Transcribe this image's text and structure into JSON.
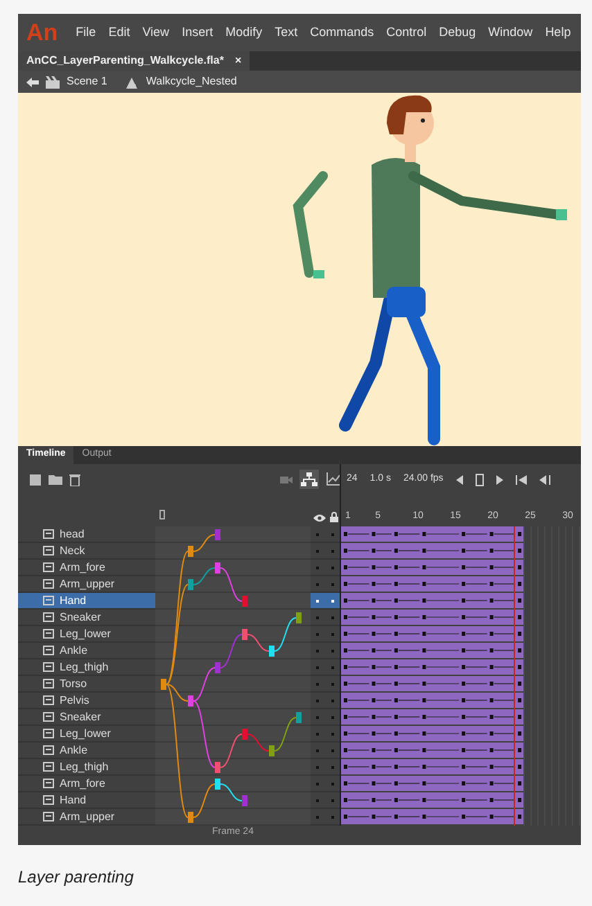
{
  "app": {
    "logo": "An",
    "menu": [
      "File",
      "Edit",
      "View",
      "Insert",
      "Modify",
      "Text",
      "Commands",
      "Control",
      "Debug",
      "Window",
      "Help"
    ]
  },
  "document_tab": {
    "title": "AnCC_LayerParenting_Walkcycle.fla*",
    "close": "×"
  },
  "breadcrumb": [
    "Scene 1",
    "Walkcycle_Nested"
  ],
  "timeline": {
    "tabs": [
      {
        "label": "Timeline",
        "selected": true
      },
      {
        "label": "Output",
        "selected": false
      }
    ],
    "frame": "24",
    "time": "1.0 s",
    "fps": "24.00 fps",
    "ruler": [
      "1",
      "5",
      "10",
      "15",
      "20",
      "25",
      "30"
    ],
    "layers": [
      {
        "name": "head",
        "selected": false,
        "color": "#a030d0"
      },
      {
        "name": "Neck",
        "selected": false,
        "color": "#e08a10"
      },
      {
        "name": "Arm_fore",
        "selected": false,
        "color": "#e040e0"
      },
      {
        "name": "Arm_upper",
        "selected": false,
        "color": "#10a0a0"
      },
      {
        "name": "Hand",
        "selected": true,
        "color": "#e01030"
      },
      {
        "name": "Sneaker",
        "selected": false,
        "color": "#80a010"
      },
      {
        "name": "Leg_lower",
        "selected": false,
        "color": "#f05070"
      },
      {
        "name": "Ankle",
        "selected": false,
        "color": "#20e0f0"
      },
      {
        "name": "Leg_thigh",
        "selected": false,
        "color": "#a030d0"
      },
      {
        "name": "Torso",
        "selected": false,
        "color": "#e08a10"
      },
      {
        "name": "Pelvis",
        "selected": false,
        "color": "#e040e0"
      },
      {
        "name": "Sneaker",
        "selected": false,
        "color": "#10a0a0"
      },
      {
        "name": "Leg_lower",
        "selected": false,
        "color": "#e01030"
      },
      {
        "name": "Ankle",
        "selected": false,
        "color": "#80a010"
      },
      {
        "name": "Leg_thigh",
        "selected": false,
        "color": "#f05070"
      },
      {
        "name": "Arm_fore",
        "selected": false,
        "color": "#20e0f0"
      },
      {
        "name": "Hand",
        "selected": false,
        "color": "#a030d0"
      },
      {
        "name": "Arm_upper",
        "selected": false,
        "color": "#e08a10"
      }
    ],
    "footer": "Frame 24"
  },
  "caption": "Layer parenting"
}
